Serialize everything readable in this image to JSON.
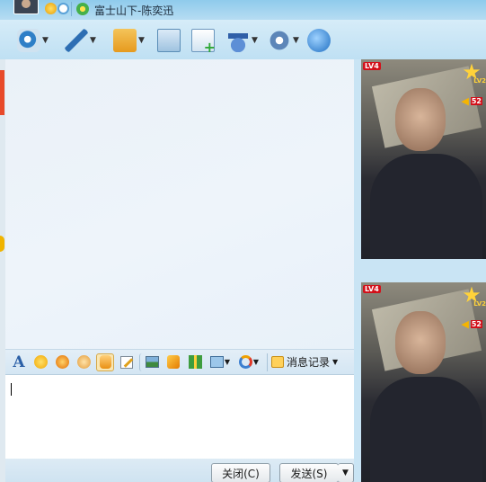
{
  "window": {
    "contact_name": "富士山下-陈奕迅"
  },
  "toolbar": {
    "items": [
      {
        "name": "video-call",
        "icon": "webcam-icon"
      },
      {
        "name": "voice-call",
        "icon": "microphone-icon"
      },
      {
        "name": "send-file",
        "icon": "folder-send-icon"
      },
      {
        "name": "send-message",
        "icon": "message-envelope-icon"
      },
      {
        "name": "create-group",
        "icon": "add-list-icon"
      },
      {
        "name": "remote-assist",
        "icon": "graduation-cap-icon"
      },
      {
        "name": "app-settings",
        "icon": "gear-icon"
      },
      {
        "name": "share",
        "icon": "share-globe-icon"
      }
    ]
  },
  "format_bar": {
    "history_label": "消息记录"
  },
  "buttons": {
    "close": "关闭(C)",
    "send": "发送(S)"
  },
  "video": {
    "level": "LV4",
    "level2": "LV2",
    "volume": "52"
  },
  "colors": {
    "accent": "#5aa2d8",
    "titlebar": "#9ed1ee",
    "level_badge": "#d3101a"
  }
}
